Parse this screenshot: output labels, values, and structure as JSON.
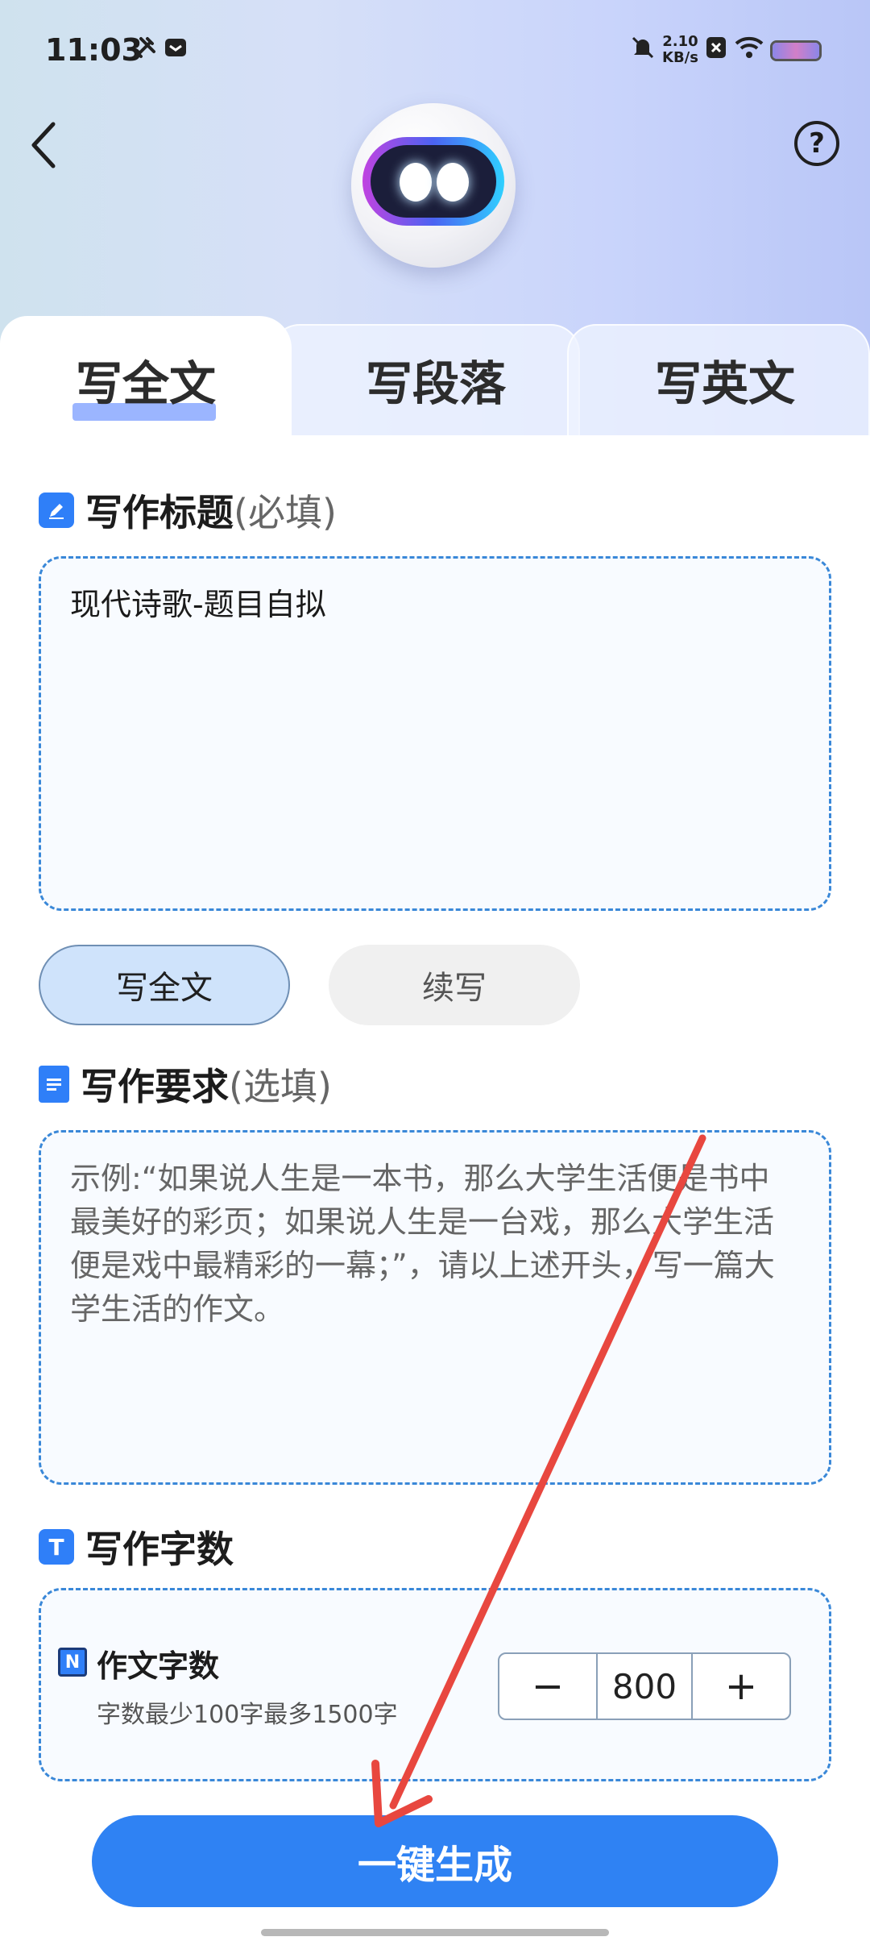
{
  "status_bar": {
    "time": "11:03",
    "net_rate_value": "2.10",
    "net_rate_unit": "KB/s",
    "icons": [
      "tools-icon",
      "mail-icon",
      "mute-icon",
      "x-icon",
      "wifi-icon",
      "battery-icon"
    ]
  },
  "header": {
    "back_icon": "chevron-left-icon",
    "help_label": "?",
    "mascot": "robot-avatar"
  },
  "tabs": [
    {
      "label": "写全文",
      "active": true
    },
    {
      "label": "写段落",
      "active": false
    },
    {
      "label": "写英文",
      "active": false
    }
  ],
  "title_section": {
    "label": "写作标题",
    "hint": "(必填)",
    "value": "现代诗歌-题目自拟"
  },
  "mode_buttons": [
    {
      "label": "写全文",
      "selected": true
    },
    {
      "label": "续写",
      "selected": false
    }
  ],
  "requirement_section": {
    "label": "写作要求",
    "hint": "(选填)",
    "placeholder": "示例:“如果说人生是一本书，那么大学生活便是书中最美好的彩页；如果说人生是一台戏，那么大学生活便是戏中最精彩的一幕；”，请以上述开头，写一篇大学生活的作文。"
  },
  "word_count_section": {
    "label": "写作字数",
    "icon_letter": "T",
    "item_label": "作文字数",
    "item_icon_letter": "N",
    "item_hint": "字数最少100字最多1500字",
    "minus": "−",
    "value": "800",
    "plus": "+"
  },
  "generate_button": "一键生成",
  "colors": {
    "accent": "#2f82f3",
    "dashed_border": "#3a88d8",
    "selected_pill": "#cfe3fb",
    "annotation_arrow": "#e8473f"
  }
}
